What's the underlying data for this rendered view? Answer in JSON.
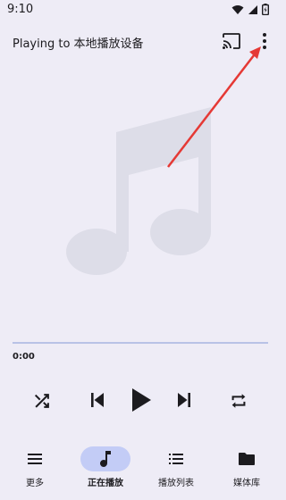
{
  "status_bar": {
    "time": "9:10"
  },
  "header": {
    "title": "Playing to 本地播放设备"
  },
  "player": {
    "elapsed": "0:00",
    "progress": 0
  },
  "nav": {
    "items": [
      {
        "label": "更多",
        "icon": "menu-icon",
        "active": false
      },
      {
        "label": "正在播放",
        "icon": "music-note-icon",
        "active": true
      },
      {
        "label": "播放列表",
        "icon": "list-icon",
        "active": false
      },
      {
        "label": "媒体库",
        "icon": "folder-icon",
        "active": false
      }
    ]
  },
  "colors": {
    "background": "#EEECF6",
    "active_pill": "#C3CCF6",
    "seek_track": "#B8C2E6",
    "artwork": "#DDDDE8",
    "annotation_arrow": "#E53935"
  }
}
